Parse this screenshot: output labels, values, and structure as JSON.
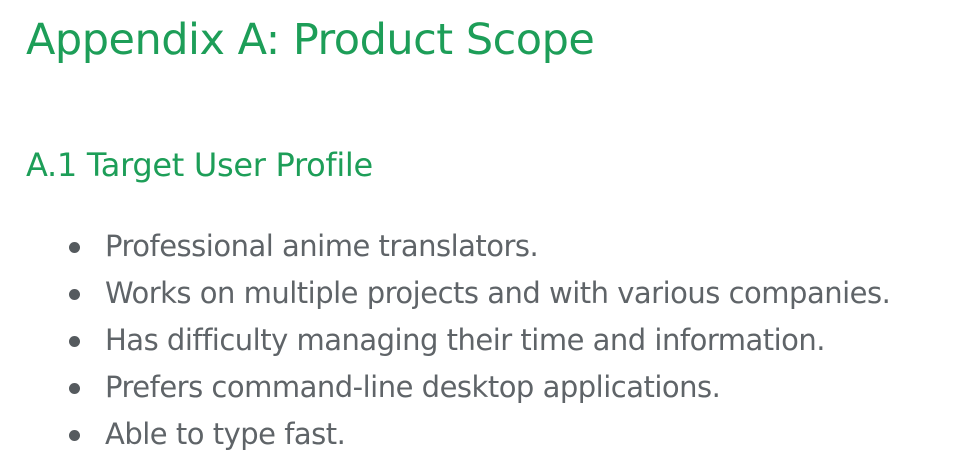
{
  "colors": {
    "heading": "#1d9e58",
    "body_text": "#5f6468",
    "bullet": "#555a5e"
  },
  "document": {
    "title": "Appendix A: Product Scope",
    "section": {
      "heading": "A.1 Target User Profile",
      "bullet_icon": "bullet-dot",
      "items": [
        {
          "text": "Professional anime translators."
        },
        {
          "text": "Works on multiple projects and with various companies."
        },
        {
          "text": "Has difficulty managing their time and information."
        },
        {
          "text": "Prefers command-line desktop applications."
        },
        {
          "text": "Able to type fast."
        }
      ]
    }
  }
}
